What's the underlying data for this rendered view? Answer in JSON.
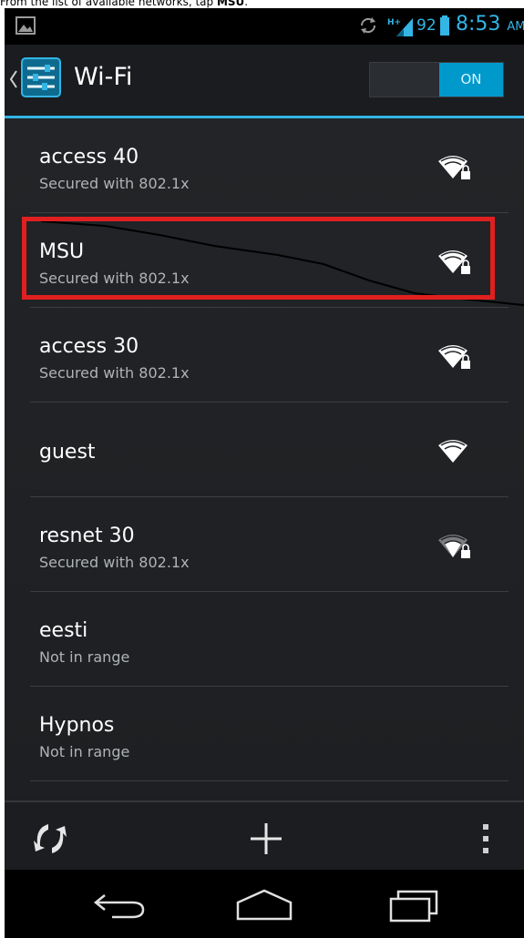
{
  "caption": {
    "prefix": "From the list of available networks, tap ",
    "bold": "MSU",
    "suffix": "."
  },
  "status_bar": {
    "icons": [
      "picture-icon",
      "sync-icon",
      "hplus-signal-icon",
      "battery-icon"
    ],
    "network_type": "H+",
    "battery_percent": "92",
    "time": "8:53",
    "ampm": "AM"
  },
  "action_bar": {
    "title": "Wi-Fi",
    "toggle_label": "ON",
    "toggle_state": "on"
  },
  "networks": [
    {
      "name": "access 40",
      "status": "Secured with 802.1x",
      "secured": true,
      "signal_icon": "wifi-locked-icon"
    },
    {
      "name": "MSU",
      "status": "Secured with 802.1x",
      "secured": true,
      "signal_icon": "wifi-locked-icon",
      "highlighted": true
    },
    {
      "name": "access 30",
      "status": "Secured with 802.1x",
      "secured": true,
      "signal_icon": "wifi-locked-icon"
    },
    {
      "name": "guest",
      "status": "",
      "secured": false,
      "signal_icon": "wifi-icon"
    },
    {
      "name": "resnet 30",
      "status": "Secured with 802.1x",
      "secured": true,
      "signal_icon": "wifi-locked-weak-icon"
    },
    {
      "name": "eesti",
      "status": "Not in range",
      "secured": false,
      "signal_icon": ""
    },
    {
      "name": "Hypnos",
      "status": "Not in range",
      "secured": false,
      "signal_icon": ""
    }
  ],
  "bottom_bar": {
    "icons": [
      "scan-icon",
      "add-network-icon",
      "overflow-menu-icon"
    ]
  },
  "nav_bar": {
    "icons": [
      "back-icon",
      "home-icon",
      "recent-apps-icon"
    ]
  },
  "colors": {
    "accent": "#33b5e5",
    "toggle_on": "#0099cc",
    "highlight": "#e02020",
    "list_bg": "#222427"
  }
}
